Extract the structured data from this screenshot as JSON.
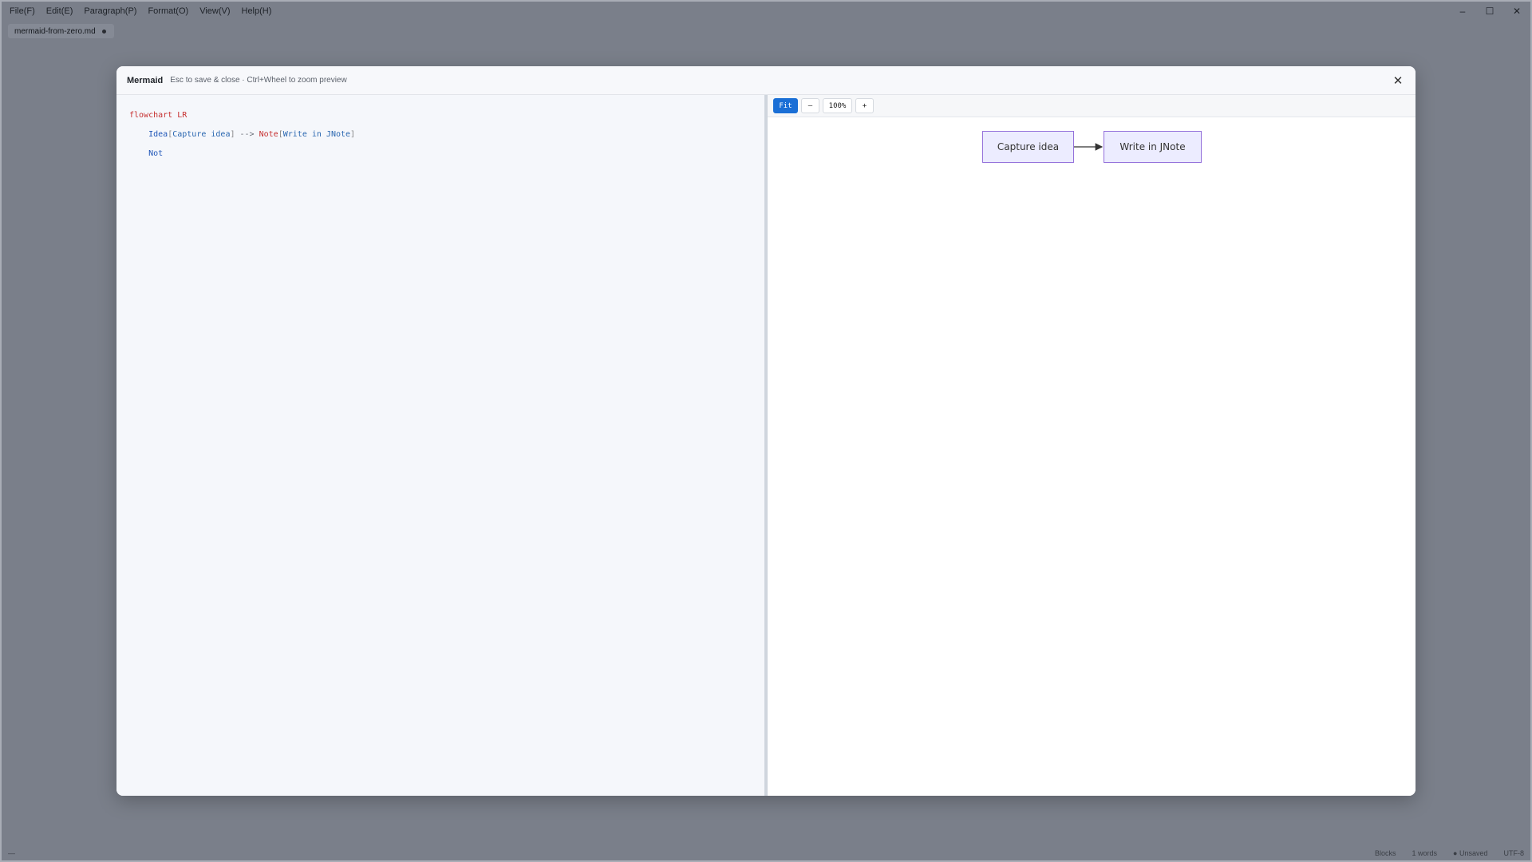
{
  "menu": {
    "items": [
      "File(F)",
      "Edit(E)",
      "Paragraph(P)",
      "Format(O)",
      "View(V)",
      "Help(H)"
    ]
  },
  "window_controls": {
    "minimize": "–",
    "maximize": "☐",
    "close": "✕"
  },
  "tab": {
    "filename": "mermaid-from-zero.md"
  },
  "modal": {
    "title": "Mermaid",
    "hint": "Esc to save & close · Ctrl+Wheel to zoom preview",
    "close_glyph": "✕"
  },
  "editor": {
    "line1": "flowchart LR",
    "line2": {
      "id1": "Idea",
      "open1": "[",
      "text1": "Capture idea",
      "close1": "]",
      "arrow": " --> ",
      "id2": "Note",
      "open2": "[",
      "text2": "Write in JNote",
      "close2": "]"
    },
    "line3": "Not"
  },
  "toolbar": {
    "fit_label": "Fit",
    "minus_label": "–",
    "zoom_label": "100%",
    "plus_label": "+"
  },
  "diagram": {
    "nodes": [
      {
        "id": "Idea",
        "label": "Capture idea"
      },
      {
        "id": "Note",
        "label": "Write in JNote"
      }
    ],
    "edges": [
      {
        "from": "Idea",
        "to": "Note"
      }
    ]
  },
  "status": {
    "left": "—",
    "blocks": "Blocks",
    "words": "1 words",
    "saved": "● Unsaved",
    "encoding": "UTF-8"
  },
  "colors": {
    "accent": "#1a6fd6",
    "node_fill": "#ececff",
    "node_stroke": "#9370db",
    "keyword": "#c62f2f",
    "identifier": "#1f56b8"
  }
}
